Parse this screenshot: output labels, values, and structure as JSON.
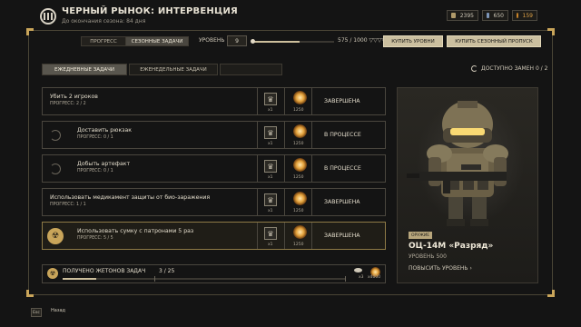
{
  "header": {
    "title": "ЧЕРНЫЙ РЫНОК: ИНТЕРВЕНЦИЯ",
    "subtitle": "До окончания сезона: 84 дня"
  },
  "currencies": [
    {
      "value": "2395",
      "icon": "crates-icon",
      "color": "#b09a6a"
    },
    {
      "value": "650",
      "icon": "bars-icon",
      "color": "#7d95b8"
    },
    {
      "value": "159",
      "icon": "coin-icon",
      "color": "#d48a2a"
    }
  ],
  "topbar": {
    "tabs": [
      {
        "label": "ПРОГРЕСС",
        "active": false
      },
      {
        "label": "СЕЗОННЫЕ ЗАДАЧИ",
        "active": true
      }
    ],
    "level_label": "УРОВЕНЬ",
    "level_value": "9",
    "xp_text": "575 / 1000",
    "xp_fraction": 0.575,
    "buy_levels": "КУПИТЬ УРОВНИ",
    "buy_pass": "КУПИТЬ СЕЗОННЫЙ ПРОПУСК"
  },
  "task_tabs": [
    {
      "label": "ЕЖЕДНЕВНЫЕ ЗАДАЧИ",
      "state": "active"
    },
    {
      "label": "ЕЖЕНЕДЕЛЬНЫЕ ЗАДАЧИ",
      "state": "normal"
    },
    {
      "label": "",
      "state": "locked"
    }
  ],
  "replace": {
    "label": "ДОСТУПНО ЗАМЕН",
    "value": "0 / 2"
  },
  "tasks": [
    {
      "name": "Убить 2 игроков",
      "progress": "ПРОГРЕСС: 2 / 2",
      "reward_count": "x1",
      "xp": "1250",
      "status": "ЗАВЕРШЕНА",
      "state": "done"
    },
    {
      "name": "Доставить рюкзак",
      "progress": "ПРОГРЕСС: 0 / 1",
      "reward_count": "x1",
      "xp": "1250",
      "status": "В ПРОЦЕССЕ",
      "state": "in_progress"
    },
    {
      "name": "Добыть артефакт",
      "progress": "ПРОГРЕСС: 0 / 1",
      "reward_count": "x1",
      "xp": "1250",
      "status": "В ПРОЦЕССЕ",
      "state": "in_progress"
    },
    {
      "name": "Использовать медикамент защиты от био-заражения",
      "progress": "ПРОГРЕСС: 1 / 1",
      "reward_count": "x1",
      "xp": "1250",
      "status": "ЗАВЕРШЕНА",
      "state": "done"
    },
    {
      "name": "Использовать сумку с патронами 5 раз",
      "progress": "ПРОГРЕСС: 5 / 5",
      "reward_count": "x1",
      "xp": "1250",
      "status": "ЗАВЕРШЕНА",
      "state": "done_highlight"
    }
  ],
  "tokens": {
    "label": "ПОЛУЧЕНО ЖЕТОНОВ ЗАДАЧ",
    "count": "3 / 25",
    "fraction": 0.12,
    "reward_count": "x3",
    "reward_xp": "x4000"
  },
  "reward": {
    "type": "ОРУЖИЕ",
    "name": "ОЦ-14М «Разряд»",
    "level": "УРОВЕНЬ 500",
    "upgrade": "ПОВЫСИТЬ УРОВЕНЬ"
  },
  "footer": {
    "esc": "Esc",
    "back": "Назад"
  }
}
